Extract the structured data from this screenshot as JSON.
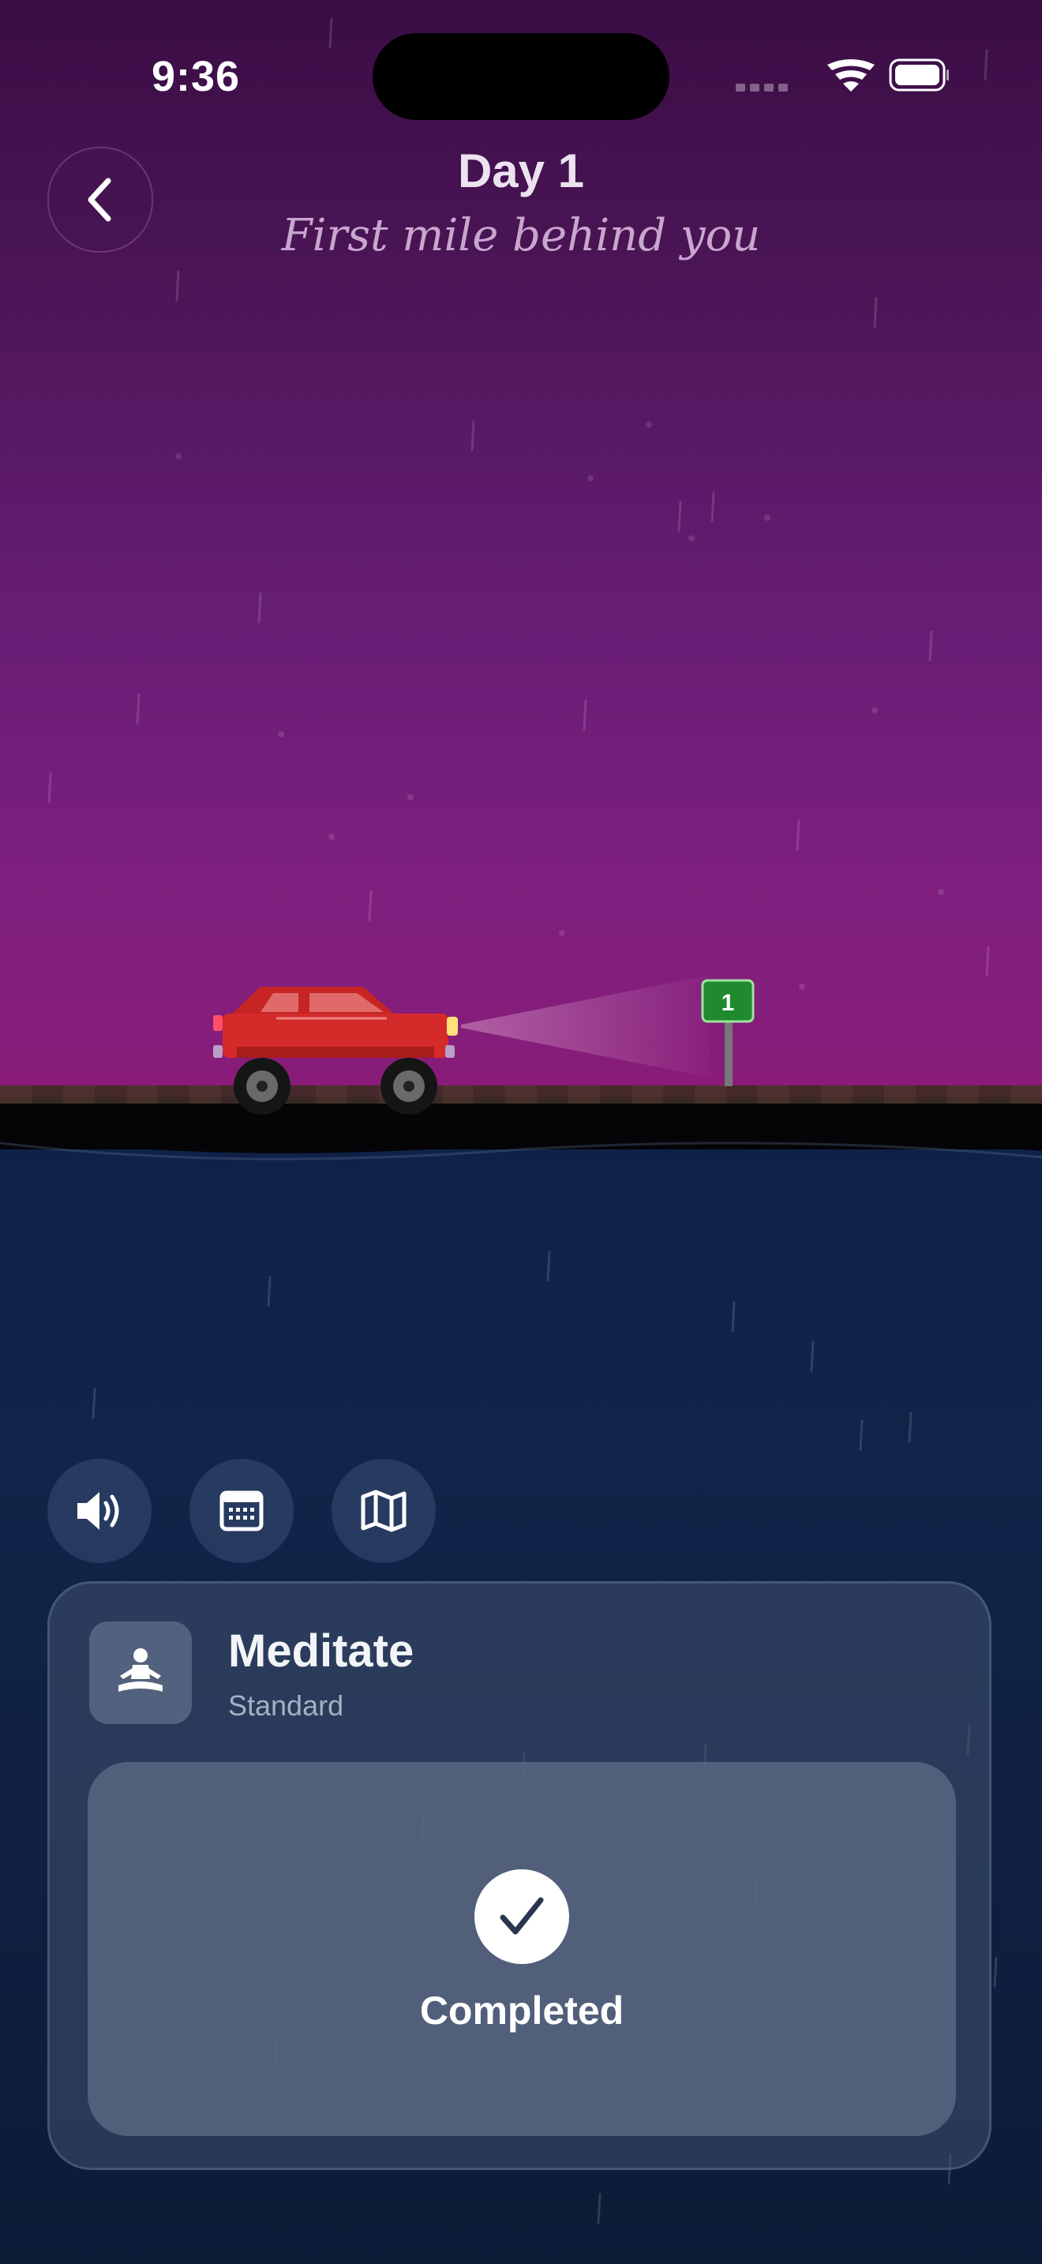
{
  "status_bar": {
    "time": "9:36"
  },
  "header": {
    "title": "Day 1",
    "subtitle": "First mile behind you"
  },
  "scene": {
    "mile_sign": "1"
  },
  "controls": [
    {
      "icon": "speaker-icon"
    },
    {
      "icon": "calendar-icon"
    },
    {
      "icon": "map-icon"
    }
  ],
  "task_card": {
    "icon": "meditate-icon",
    "title": "Meditate",
    "subtitle": "Standard",
    "status": "Completed"
  },
  "colors": {
    "sky_top": "#3a0d45",
    "sky_bottom": "#8a1c78",
    "sea": "#0f2147",
    "car": "#d42a2a",
    "sign": "#1f8a2e"
  }
}
